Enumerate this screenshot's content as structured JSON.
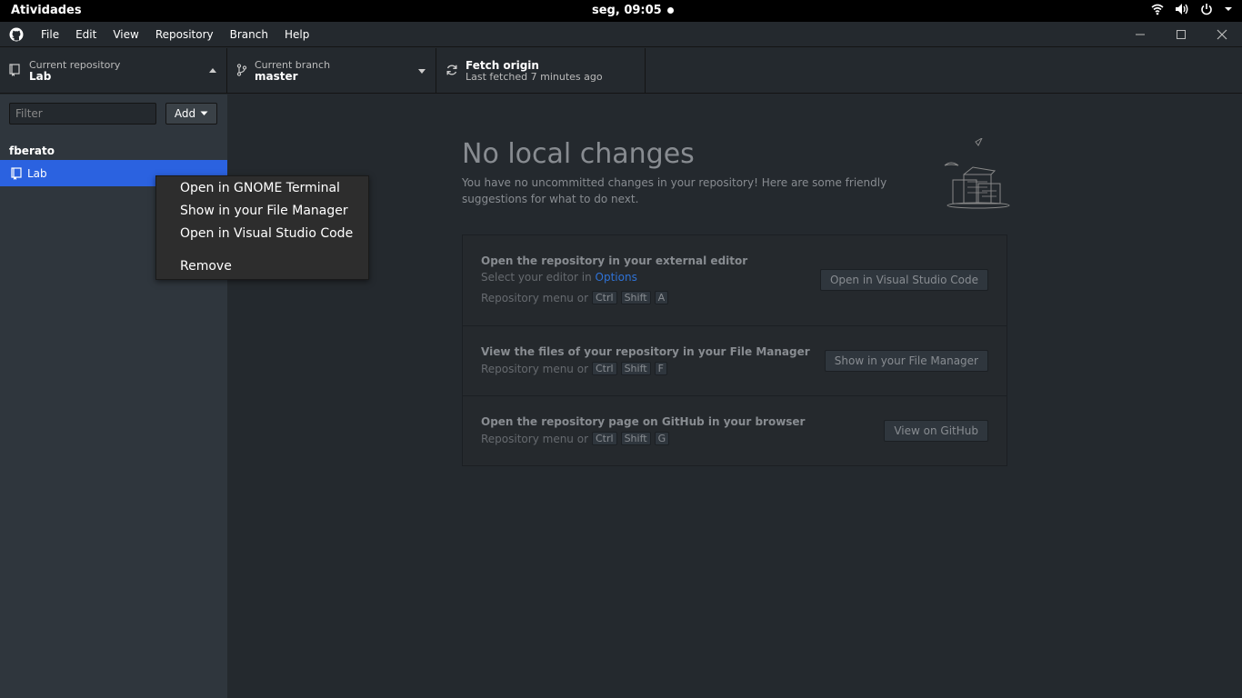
{
  "topbar": {
    "activities": "Atividades",
    "clock": "seg, 09:05",
    "tray_icons": [
      "wifi-icon",
      "volume-icon",
      "power-icon",
      "chevron-down-icon"
    ]
  },
  "menubar": {
    "items": [
      "File",
      "Edit",
      "View",
      "Repository",
      "Branch",
      "Help"
    ]
  },
  "toolbar": {
    "repo_label": "Current repository",
    "repo_value": "Lab",
    "branch_label": "Current branch",
    "branch_value": "master",
    "fetch_label": "Fetch origin",
    "fetch_sub": "Last fetched 7 minutes ago"
  },
  "sidebar": {
    "filter_placeholder": "Filter",
    "add_label": "Add",
    "group": "fberato",
    "repos": [
      {
        "name": "Lab",
        "selected": true
      }
    ]
  },
  "context_menu": {
    "items": [
      "Open in GNOME Terminal",
      "Show in your File Manager",
      "Open in Visual Studio Code",
      "Remove"
    ]
  },
  "main": {
    "title": "No local changes",
    "description": "You have no uncommitted changes in your repository! Here are some friendly suggestions for what to do next.",
    "actions": [
      {
        "title": "Open the repository in your external editor",
        "sub_prefix": "Select your editor in",
        "sub_link": "Options",
        "keys_prefix": "Repository menu or",
        "keys": [
          "Ctrl",
          "Shift",
          "A"
        ],
        "button": "Open in Visual Studio Code"
      },
      {
        "title": "View the files of your repository in your File Manager",
        "keys_prefix": "Repository menu or",
        "keys": [
          "Ctrl",
          "Shift",
          "F"
        ],
        "button": "Show in your File Manager"
      },
      {
        "title": "Open the repository page on GitHub in your browser",
        "keys_prefix": "Repository menu or",
        "keys": [
          "Ctrl",
          "Shift",
          "G"
        ],
        "button": "View on GitHub"
      }
    ]
  },
  "colors": {
    "selection": "#2b62e0",
    "link": "#2f72d6",
    "background": "#24292e"
  }
}
